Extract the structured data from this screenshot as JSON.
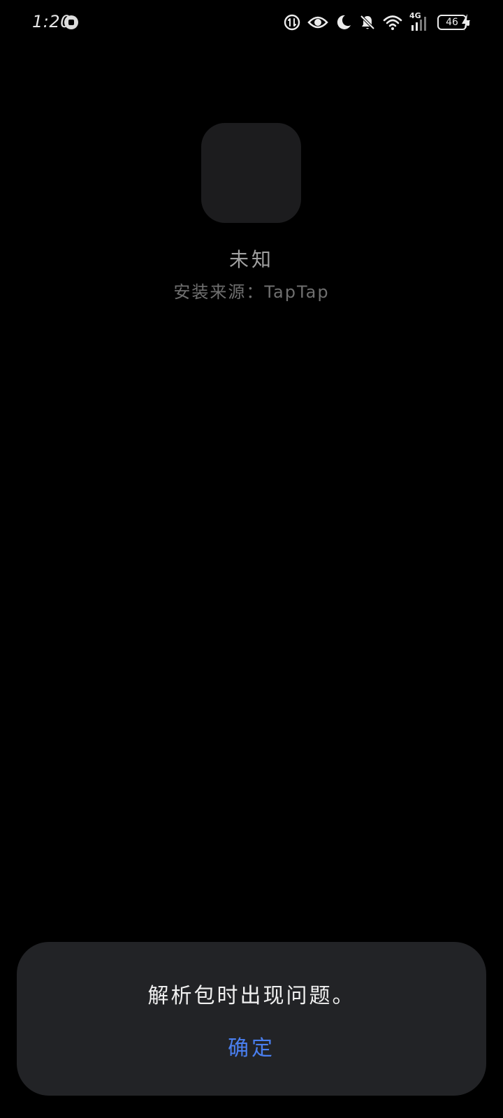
{
  "status_bar": {
    "time": "1:20",
    "network_type": "4G",
    "battery_level": "46",
    "icons": [
      "notification-dot-icon",
      "data-saver-icon",
      "eye-comfort-icon",
      "do-not-disturb-moon-icon",
      "bell-muted-icon",
      "wifi-icon",
      "cellular-signal-icon",
      "battery-icon",
      "charging-bolt-icon"
    ]
  },
  "app_info": {
    "name": "未知",
    "install_source": "安装来源：TapTap"
  },
  "dialog": {
    "message": "解析包时出现问题。",
    "confirm_label": "确定",
    "accent_color": "#4a7ff0"
  },
  "colors": {
    "background": "#000000",
    "dialog_background": "#222326",
    "app_icon_placeholder": "#1c1c1e"
  }
}
